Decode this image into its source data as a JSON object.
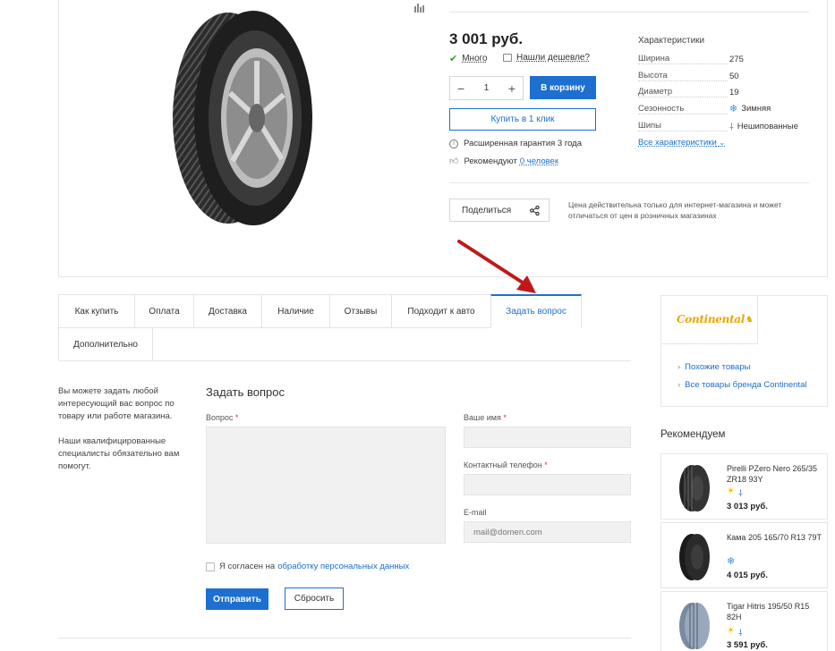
{
  "product": {
    "price": "3 001 руб.",
    "stock": "Много",
    "cheaper": "Нашли дешевле?",
    "qty": "1",
    "qty_minus": "−",
    "qty_plus": "+",
    "cart_btn": "В корзину",
    "oneclick_btn": "Купить в 1 клик",
    "warranty": "Расширенная гарантия 3 года",
    "recommend_prefix": "Рекомендуют",
    "recommend_link": "0 человек",
    "share_btn": "Поделиться",
    "price_note": "Цена действительна только для интернет-магазина и может отличаться от цен в розничных магазинах"
  },
  "characteristics": {
    "title": "Характеристики",
    "rows": [
      {
        "key": "Ширина",
        "value": "275"
      },
      {
        "key": "Высота",
        "value": "50"
      },
      {
        "key": "Диаметр",
        "value": "19"
      },
      {
        "key": "Сезонность",
        "value": "Зимняя",
        "icon": "snowflake-icon"
      },
      {
        "key": "Шипы",
        "value": "Нешипованные",
        "icon": "stud-icon"
      }
    ],
    "all_link": "Все характеристики"
  },
  "tabs": [
    {
      "label": "Как купить"
    },
    {
      "label": "Оплата"
    },
    {
      "label": "Доставка"
    },
    {
      "label": "Наличие"
    },
    {
      "label": "Отзывы"
    },
    {
      "label": "Подходит к авто"
    },
    {
      "label": "Задать вопрос",
      "active": true
    },
    {
      "label": "Дополнительно"
    }
  ],
  "question_form": {
    "side_note_1": "Вы можете задать любой интересующий вас вопрос по товару или работе магазина.",
    "side_note_2": "Наши квалифицированные специалисты обязательно вам помогут.",
    "title": "Задать вопрос",
    "question_label": "Вопрос",
    "name_label": "Ваше имя",
    "phone_label": "Контактный телефон",
    "email_label": "E-mail",
    "email_placeholder": "mail@domen.com",
    "required_mark": "*",
    "agree_prefix": "Я согласен на",
    "agree_link": "обработку персональных данных",
    "send_btn": "Отправить",
    "reset_btn": "Сбросить"
  },
  "brand": {
    "logo_text": "Continental",
    "links": [
      "Похожие товары",
      "Все товары бренда Continental"
    ]
  },
  "recommended": {
    "title": "Рекомендуем",
    "items": [
      {
        "name": "Pirelli PZero Nero 265/35 ZR18 93Y",
        "price": "3 013 руб.",
        "icons": [
          "sun-icon",
          "stud-icon"
        ]
      },
      {
        "name": "Кама 205 165/70 R13 79T",
        "price": "4 015 руб.",
        "icons": [
          "snowflake-sun-icon"
        ]
      },
      {
        "name": "Tigar Hitris 195/50 R15 82H",
        "price": "3 591 руб.",
        "icons": [
          "sun-icon",
          "stud-icon"
        ]
      }
    ]
  },
  "colors": {
    "accent": "#1d6fd0",
    "price_text": "#222222",
    "brand_logo": "#f0a500",
    "arrow": "#c01818"
  }
}
